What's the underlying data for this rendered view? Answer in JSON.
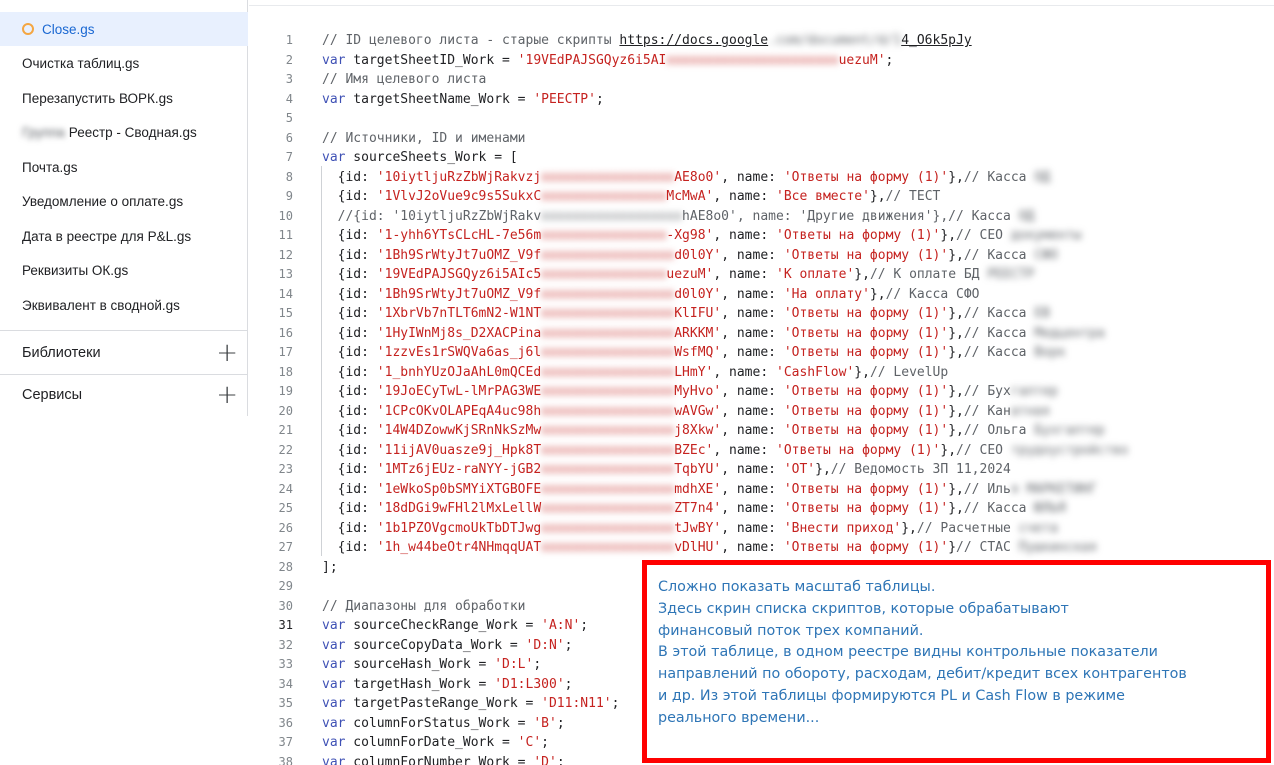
{
  "sidebar": {
    "files": [
      {
        "name": "Close.gs",
        "prefix": ""
      },
      {
        "name": "Очистка таблиц.gs",
        "prefix": ""
      },
      {
        "name": "Перезапустить ВОРК.gs",
        "prefix": ""
      },
      {
        "name": "Реестр - Сводная.gs",
        "prefix": "Группа"
      },
      {
        "name": "Почта.gs",
        "prefix": ""
      },
      {
        "name": "Уведомление о оплате.gs",
        "prefix": ""
      },
      {
        "name": "Дата в реестре для P&L.gs",
        "prefix": ""
      },
      {
        "name": "Реквизиты ОК.gs",
        "prefix": ""
      },
      {
        "name": "Эквивалент в сводной.gs",
        "prefix": ""
      }
    ],
    "libraries_label": "Библиотеки",
    "services_label": "Сервисы",
    "plus_icon": "+"
  },
  "editor": {
    "current_line": 31,
    "lines": [
      {
        "n": 1,
        "parts": [
          [
            "cm",
            "// ID целевого листа - старые скрипты "
          ],
          [
            "lnk",
            "https://docs.google"
          ],
          [
            "blurc",
            ".com/document/d/1"
          ],
          [
            "lnk",
            "4_O6k5pJy"
          ]
        ]
      },
      {
        "n": 2,
        "parts": [
          [
            "kw",
            "var"
          ],
          [
            "",
            ""
          ],
          [
            "",
            " targetSheetID_Work = "
          ],
          [
            "st",
            "'19VEdPAJSGQyz6i5AI"
          ],
          [
            "blur",
            "xxxxxxxxxxxxxxxxxxxxxx"
          ],
          [
            "st",
            "uezuM'"
          ],
          [
            "",
            ";"
          ]
        ]
      },
      {
        "n": 3,
        "parts": [
          [
            "cm",
            "// Имя целевого листа"
          ]
        ]
      },
      {
        "n": 4,
        "parts": [
          [
            "kw",
            "var"
          ],
          [
            "",
            " targetSheetName_Work = "
          ],
          [
            "st",
            "'РЕЕСТР'"
          ],
          [
            "",
            ";"
          ]
        ]
      },
      {
        "n": 5,
        "parts": []
      },
      {
        "n": 6,
        "parts": [
          [
            "cm",
            "// Источники, ID и именами"
          ]
        ]
      },
      {
        "n": 7,
        "parts": [
          [
            "kw",
            "var"
          ],
          [
            "",
            " sourceSheets_Work = ["
          ]
        ]
      },
      {
        "n": 8,
        "parts": [
          [
            "",
            "  {id: "
          ],
          [
            "st",
            "'10iytljuRzZbWjRakvzj"
          ],
          [
            "blur",
            "xxxxxxxxxxxxxxxxx"
          ],
          [
            "st",
            "AE8o0'"
          ],
          [
            "",
            ", name: "
          ],
          [
            "st",
            "'Ответы на форму (1)'"
          ],
          [
            "",
            "},"
          ],
          [
            "cm",
            "// Касса "
          ],
          [
            "blurc",
            "ОД"
          ]
        ]
      },
      {
        "n": 9,
        "parts": [
          [
            "",
            "  {id: "
          ],
          [
            "st",
            "'1VlvJ2oVue9c9s5SukxC"
          ],
          [
            "blur",
            "xxxxxxxxxxxxxxxx"
          ],
          [
            "st",
            "McMwA'"
          ],
          [
            "",
            ", name: "
          ],
          [
            "st",
            "'Все вместе'"
          ],
          [
            "",
            "},"
          ],
          [
            "cm",
            "// ТЕСТ"
          ]
        ]
      },
      {
        "n": 10,
        "parts": [
          [
            "cm",
            "  //{id: '10iytljuRzZbWjRakv"
          ],
          [
            "blurc",
            "xxxxxxxxxxxxxxxxxx"
          ],
          [
            "cm",
            "hAE8o0', name: 'Другие движения'},// Касса "
          ],
          [
            "blurc",
            "ОД"
          ]
        ]
      },
      {
        "n": 11,
        "parts": [
          [
            "",
            "  {id: "
          ],
          [
            "st",
            "'1-yhh6YTsCLcHL-7e56m"
          ],
          [
            "blur",
            "xxxxxxxxxxxxxxxx"
          ],
          [
            "st",
            "-Xg98'"
          ],
          [
            "",
            ", name: "
          ],
          [
            "st",
            "'Ответы на форму (1)'"
          ],
          [
            "",
            "},"
          ],
          [
            "cm",
            "// СЕО "
          ],
          [
            "blurc",
            "документы"
          ]
        ]
      },
      {
        "n": 12,
        "parts": [
          [
            "",
            "  {id: "
          ],
          [
            "st",
            "'1Bh9SrWtyJt7uOMZ_V9f"
          ],
          [
            "blur",
            "xxxxxxxxxxxxxxxxx"
          ],
          [
            "st",
            "d0l0Y'"
          ],
          [
            "",
            ", name: "
          ],
          [
            "st",
            "'Ответы на форму (1)'"
          ],
          [
            "",
            "},"
          ],
          [
            "cm",
            "// Касса "
          ],
          [
            "blurc",
            "СФО"
          ]
        ]
      },
      {
        "n": 13,
        "parts": [
          [
            "",
            "  {id: "
          ],
          [
            "st",
            "'19VEdPAJSGQyz6i5AIc5"
          ],
          [
            "blur",
            "xxxxxxxxxxxxxxxx"
          ],
          [
            "st",
            "uezuM'"
          ],
          [
            "",
            ", name: "
          ],
          [
            "st",
            "'К оплате'"
          ],
          [
            "",
            "},"
          ],
          [
            "cm",
            "// К оплате БД "
          ],
          [
            "blurc",
            "РЕЕСТР"
          ]
        ]
      },
      {
        "n": 14,
        "parts": [
          [
            "",
            "  {id: "
          ],
          [
            "st",
            "'1Bh9SrWtyJt7uOMZ_V9f"
          ],
          [
            "blur",
            "xxxxxxxxxxxxxxxxx"
          ],
          [
            "st",
            "d0l0Y'"
          ],
          [
            "",
            ", name: "
          ],
          [
            "st",
            "'На оплату'"
          ],
          [
            "",
            "},"
          ],
          [
            "cm",
            "// Касса СФО"
          ]
        ]
      },
      {
        "n": 15,
        "parts": [
          [
            "",
            "  {id: "
          ],
          [
            "st",
            "'1XbrVb7nTLT6mN2-W1NT"
          ],
          [
            "blur",
            "xxxxxxxxxxxxxxxxx"
          ],
          [
            "st",
            "KlIFU'"
          ],
          [
            "",
            ", name: "
          ],
          [
            "st",
            "'Ответы на форму (1)'"
          ],
          [
            "",
            "},"
          ],
          [
            "cm",
            "// Касса "
          ],
          [
            "blurc",
            "ЕВ"
          ]
        ]
      },
      {
        "n": 16,
        "parts": [
          [
            "",
            "  {id: "
          ],
          [
            "st",
            "'1HyIWnMj8s_D2XACPina"
          ],
          [
            "blur",
            "xxxxxxxxxxxxxxxxx"
          ],
          [
            "st",
            "ARKKM'"
          ],
          [
            "",
            ", name: "
          ],
          [
            "st",
            "'Ответы на форму (1)'"
          ],
          [
            "",
            "},"
          ],
          [
            "cm",
            "// Касса "
          ],
          [
            "blurc",
            "Медцентра"
          ]
        ]
      },
      {
        "n": 17,
        "parts": [
          [
            "",
            "  {id: "
          ],
          [
            "st",
            "'1zzvEs1rSWQVa6as_j6l"
          ],
          [
            "blur",
            "xxxxxxxxxxxxxxxxx"
          ],
          [
            "st",
            "WsfMQ'"
          ],
          [
            "",
            ", name: "
          ],
          [
            "st",
            "'Ответы на форму (1)'"
          ],
          [
            "",
            "},"
          ],
          [
            "cm",
            "// Касса "
          ],
          [
            "blurc",
            "Ворк"
          ]
        ]
      },
      {
        "n": 18,
        "parts": [
          [
            "",
            "  {id: "
          ],
          [
            "st",
            "'1_bnhYUzOJaAhL0mQCEd"
          ],
          [
            "blur",
            "xxxxxxxxxxxxxxxxx"
          ],
          [
            "st",
            "LHmY'"
          ],
          [
            "",
            ", name: "
          ],
          [
            "st",
            "'CashFlow'"
          ],
          [
            "",
            "},"
          ],
          [
            "cm",
            "// LevelUp"
          ]
        ]
      },
      {
        "n": 19,
        "parts": [
          [
            "",
            "  {id: "
          ],
          [
            "st",
            "'19JoECyTwL-lMrPAG3WE"
          ],
          [
            "blur",
            "xxxxxxxxxxxxxxxxx"
          ],
          [
            "st",
            "MyHvo'"
          ],
          [
            "",
            ", name: "
          ],
          [
            "st",
            "'Ответы на форму (1)'"
          ],
          [
            "",
            "},"
          ],
          [
            "cm",
            "// Бух"
          ],
          [
            "blurc",
            "галтер"
          ]
        ]
      },
      {
        "n": 20,
        "parts": [
          [
            "",
            "  {id: "
          ],
          [
            "st",
            "'1CPcOKvOLAPEqA4uc98h"
          ],
          [
            "blur",
            "xxxxxxxxxxxxxxxxx"
          ],
          [
            "st",
            "wAVGw'"
          ],
          [
            "",
            ", name: "
          ],
          [
            "st",
            "'Ответы на форму (1)'"
          ],
          [
            "",
            "},"
          ],
          [
            "cm",
            "// Кан"
          ],
          [
            "blurc",
            "атная"
          ]
        ]
      },
      {
        "n": 21,
        "parts": [
          [
            "",
            "  {id: "
          ],
          [
            "st",
            "'14W4DZowwKjSRnNkSzMw"
          ],
          [
            "blur",
            "xxxxxxxxxxxxxxxxx"
          ],
          [
            "st",
            "j8Xkw'"
          ],
          [
            "",
            ", name: "
          ],
          [
            "st",
            "'Ответы на форму (1)'"
          ],
          [
            "",
            "},"
          ],
          [
            "cm",
            "// Ольга "
          ],
          [
            "blurc",
            "Бухгалтер"
          ]
        ]
      },
      {
        "n": 22,
        "parts": [
          [
            "",
            "  {id: "
          ],
          [
            "st",
            "'11ijAV0uasze9j_Hpk8T"
          ],
          [
            "blur",
            "xxxxxxxxxxxxxxxxx"
          ],
          [
            "st",
            "BZEc'"
          ],
          [
            "",
            ", name: "
          ],
          [
            "st",
            "'Ответы на форму (1)'"
          ],
          [
            "",
            "},"
          ],
          [
            "cm",
            "// СЕО "
          ],
          [
            "blurc",
            "трудоустройство"
          ]
        ]
      },
      {
        "n": 23,
        "parts": [
          [
            "",
            "  {id: "
          ],
          [
            "st",
            "'1MTz6jEUz-raNYY-jGB2"
          ],
          [
            "blur",
            "xxxxxxxxxxxxxxxxx"
          ],
          [
            "st",
            "TqbYU'"
          ],
          [
            "",
            ", name: "
          ],
          [
            "st",
            "'ОТ'"
          ],
          [
            "",
            "},"
          ],
          [
            "cm",
            "// Ведомость ЗП 11,2024"
          ]
        ]
      },
      {
        "n": 24,
        "parts": [
          [
            "",
            "  {id: "
          ],
          [
            "st",
            "'1eWkoSp0bSMYiXTGBOFE"
          ],
          [
            "blur",
            "xxxxxxxxxxxxxxxxx"
          ],
          [
            "st",
            "mdhXE'"
          ],
          [
            "",
            ", name: "
          ],
          [
            "st",
            "'Ответы на форму (1)'"
          ],
          [
            "",
            "},"
          ],
          [
            "cm",
            "// Иль"
          ],
          [
            "blurc",
            "я МАРКЕТИНГ"
          ]
        ]
      },
      {
        "n": 25,
        "parts": [
          [
            "",
            "  {id: "
          ],
          [
            "st",
            "'18dDGi9wFHl2lMxLellW"
          ],
          [
            "blur",
            "xxxxxxxxxxxxxxxxx"
          ],
          [
            "st",
            "ZT7n4'"
          ],
          [
            "",
            ", name: "
          ],
          [
            "st",
            "'Ответы на форму (1)'"
          ],
          [
            "",
            "},"
          ],
          [
            "cm",
            "// Касса "
          ],
          [
            "blurc",
            "ЮЛЬЯ"
          ]
        ]
      },
      {
        "n": 26,
        "parts": [
          [
            "",
            "  {id: "
          ],
          [
            "st",
            "'1b1PZOVgcmoUkTbDTJwg"
          ],
          [
            "blur",
            "xxxxxxxxxxxxxxxxx"
          ],
          [
            "st",
            "tJwBY'"
          ],
          [
            "",
            ", name: "
          ],
          [
            "st",
            "'Внести приход'"
          ],
          [
            "",
            "},"
          ],
          [
            "cm",
            "// Расчетные "
          ],
          [
            "blurc",
            "счета"
          ]
        ]
      },
      {
        "n": 27,
        "parts": [
          [
            "",
            "  {id: "
          ],
          [
            "st",
            "'1h_w44beOtr4NHmqqUAT"
          ],
          [
            "blur",
            "xxxxxxxxxxxxxxxxx"
          ],
          [
            "st",
            "vDlHU'"
          ],
          [
            "",
            ", name: "
          ],
          [
            "st",
            "'Ответы на форму (1)'"
          ],
          [
            "",
            "}"
          ],
          [
            "cm",
            "// СТАС "
          ],
          [
            "blurc",
            "Пушкинская"
          ]
        ]
      },
      {
        "n": 28,
        "parts": [
          [
            "",
            "];"
          ]
        ]
      },
      {
        "n": 29,
        "parts": []
      },
      {
        "n": 30,
        "parts": [
          [
            "cm",
            "// Диапазоны для обработки"
          ]
        ]
      },
      {
        "n": 31,
        "parts": [
          [
            "kw",
            "var"
          ],
          [
            "",
            " sourceCheckRange_Work = "
          ],
          [
            "st",
            "'A:N'"
          ],
          [
            "",
            ";"
          ]
        ]
      },
      {
        "n": 32,
        "parts": [
          [
            "kw",
            "var"
          ],
          [
            "",
            " sourceCopyData_Work = "
          ],
          [
            "st",
            "'D:N'"
          ],
          [
            "",
            ";"
          ]
        ]
      },
      {
        "n": 33,
        "parts": [
          [
            "kw",
            "var"
          ],
          [
            "",
            " sourceHash_Work = "
          ],
          [
            "st",
            "'D:L'"
          ],
          [
            "",
            ";"
          ]
        ]
      },
      {
        "n": 34,
        "parts": [
          [
            "kw",
            "var"
          ],
          [
            "",
            " targetHash_Work = "
          ],
          [
            "st",
            "'D1:L300'"
          ],
          [
            "",
            ";"
          ]
        ]
      },
      {
        "n": 35,
        "parts": [
          [
            "kw",
            "var"
          ],
          [
            "",
            " targetPasteRange_Work = "
          ],
          [
            "st",
            "'D11:N11'"
          ],
          [
            "",
            ";"
          ]
        ]
      },
      {
        "n": 36,
        "parts": [
          [
            "kw",
            "var"
          ],
          [
            "",
            " columnForStatus_Work = "
          ],
          [
            "st",
            "'B'"
          ],
          [
            "",
            ";"
          ]
        ]
      },
      {
        "n": 37,
        "parts": [
          [
            "kw",
            "var"
          ],
          [
            "",
            " columnForDate_Work = "
          ],
          [
            "st",
            "'C'"
          ],
          [
            "",
            ";"
          ]
        ]
      },
      {
        "n": 38,
        "parts": [
          [
            "kw",
            "var"
          ],
          [
            "",
            " columnForNumber_Work = "
          ],
          [
            "st",
            "'D'"
          ],
          [
            "",
            ";"
          ]
        ]
      }
    ]
  },
  "annotation": {
    "lines": [
      "Сложно показать масштаб таблицы.",
      "Здесь скрин списка скриптов, которые обрабатывают",
      "финансовый поток трех компаний.",
      "В этой таблице, в одном реестре видны контрольные показатели",
      "направлений по обороту, расходам, дебит/кредит всех контрагентов",
      " и др. Из этой таблицы формируются PL и Cash Flow в режиме",
      "реального времени..."
    ]
  }
}
